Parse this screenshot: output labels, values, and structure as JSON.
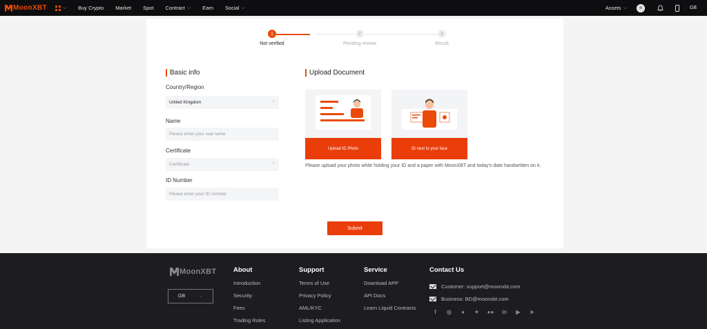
{
  "nav": {
    "brand": "MoonXBT",
    "items": [
      "Buy Crypto",
      "Market",
      "Spot",
      "Contract",
      "Earn",
      "Social"
    ],
    "assets": "Assets",
    "language": "GB"
  },
  "steps": [
    {
      "number": "1",
      "label": "Not verified"
    },
    {
      "number": "2",
      "label": "Pending review"
    },
    {
      "number": "3",
      "label": "Result"
    }
  ],
  "basic_info": {
    "title": "Basic info",
    "country_label": "Country/Region",
    "country_value": "United Kingdom",
    "name_label": "Name",
    "name_placeholder": "Please enter your real name",
    "certificate_label": "Certificate",
    "certificate_placeholder": "Certificate",
    "id_label": "ID Number",
    "id_placeholder": "Please enter your ID number"
  },
  "upload": {
    "title": "Upload Document",
    "id_photo_button": "Upload ID Photo",
    "face_button": "ID next to your face",
    "hint": "Please upload your photo while holding your ID and a paper with MoonXBT and today's date handwritten on it."
  },
  "submit_label": "Submit",
  "footer": {
    "brand": "MoonXBT",
    "language": "GB",
    "about": {
      "title": "About",
      "links": [
        "Introduction",
        "Security",
        "Fees",
        "Trading Rules"
      ]
    },
    "support": {
      "title": "Support",
      "links": [
        "Terms of Use",
        "Privacy Policy",
        "AML/KYC",
        "Listing Application"
      ]
    },
    "service": {
      "title": "Service",
      "links": [
        "Download APP",
        "API Docs",
        "Learn Liquid Contracts"
      ]
    },
    "contact": {
      "title": "Contact Us",
      "customer": "Customer: support@moonxbt.com",
      "business": "Business: BD@moonxbt.com"
    },
    "social_icons": [
      "facebook-icon",
      "instagram-icon",
      "reddit-icon",
      "twitter-icon",
      "medium-icon",
      "linkedin-icon",
      "youtube-icon",
      "telegram-icon"
    ]
  },
  "colors": {
    "accent": "#ea4b0a",
    "button": "#ea3d0a",
    "nav_bg": "#0e0e10",
    "footer_bg": "#1d1d21"
  }
}
